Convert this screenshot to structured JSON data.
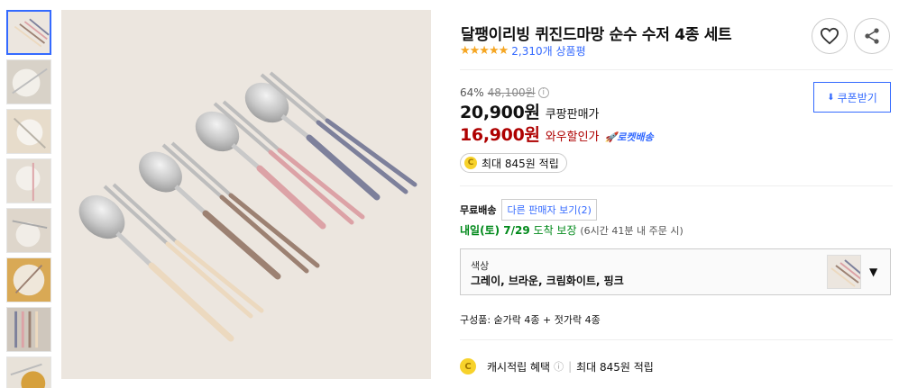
{
  "product": {
    "title": "달팽이리빙 퀴진드마망 순수 수저 4종 세트",
    "stars": "★★★★★",
    "review_count": "2,310개 상품평"
  },
  "pricing": {
    "discount_rate": "64%",
    "original_price": "48,100원",
    "info_icon": "i",
    "coupang_price": "20,900원",
    "coupang_label": "쿠팡판매가",
    "wow_price": "16,900원",
    "wow_label": "와우할인가",
    "rocket_label": "로켓배송",
    "coupon_label": "쿠폰받기",
    "coupon_icon": "⬇"
  },
  "points": {
    "coin": "C",
    "text": "최대 845원 적립"
  },
  "shipping": {
    "label": "무료배송",
    "other_sellers": "다른 판매자 보기(2)",
    "arrival_day": "내일(토) 7/29",
    "arrival_suffix": "도착 보장",
    "arrival_note": "(6시간 41분 내 주문 시)"
  },
  "option": {
    "label": "색상",
    "value": "그레이, 브라운, 크림화이트, 핑크",
    "caret": "▼"
  },
  "components": "구성품: 숟가락 4종 + 젓가락 4종",
  "cash": {
    "coin": "C",
    "label": "캐시적립 혜택",
    "info": "ⓘ",
    "separator": "|",
    "amount": "최대 845원 적립"
  },
  "icons": [
    "heart-icon",
    "share-icon",
    "download-icon",
    "rocket-icon",
    "coin-icon",
    "info-icon",
    "chevron-down-icon"
  ],
  "colors": {
    "accent_blue": "#346aff",
    "sale_red": "#ae0000",
    "arrival_green": "#00891a",
    "star": "#f5a623",
    "handle_cream": "#ecd9bf",
    "handle_brown": "#9c8172",
    "handle_pink": "#dca2a6",
    "handle_gray": "#7d809b"
  }
}
